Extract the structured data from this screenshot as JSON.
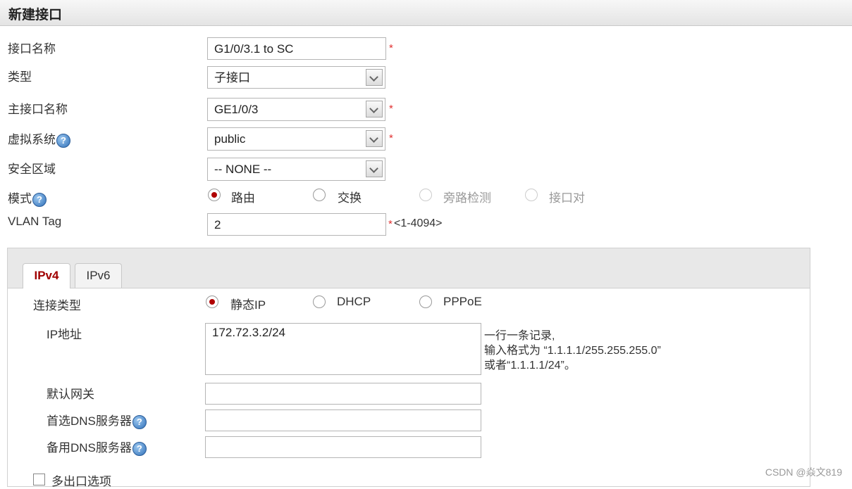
{
  "title": "新建接口",
  "form": {
    "name_label": "接口名称",
    "name_value": "G1/0/3.1 to SC",
    "type_label": "类型",
    "type_value": "子接口",
    "parent_label": "主接口名称",
    "parent_value": "GE1/0/3",
    "vsys_label": "虚拟系统",
    "vsys_value": "public",
    "zone_label": "安全区域",
    "zone_value": "-- NONE --",
    "mode_label": "模式",
    "mode_options": [
      "路由",
      "交换",
      "旁路检测",
      "接口对"
    ],
    "mode_selected": "路由",
    "vlan_label": "VLAN Tag",
    "vlan_value": "2",
    "vlan_range": "<1-4094>",
    "required_mark": "*",
    "help_glyph": "?"
  },
  "tabs": [
    "IPv4",
    "IPv6"
  ],
  "active_tab": "IPv4",
  "ipv4": {
    "conn_label": "连接类型",
    "conn_options": [
      "静态IP",
      "DHCP",
      "PPPoE"
    ],
    "conn_selected": "静态IP",
    "ip_label": "IP地址",
    "ip_value": "172.72.3.2/24",
    "ip_hint_1": "一行一条记录,",
    "ip_hint_2": "输入格式为 “1.1.1.1/255.255.255.0”",
    "ip_hint_3": "或者“1.1.1.1/24”。",
    "gateway_label": "默认网关",
    "gateway_value": "",
    "dns1_label": "首选DNS服务器",
    "dns1_value": "",
    "dns2_label": "备用DNS服务器",
    "dns2_value": "",
    "multi_exit_label": "多出口选项"
  },
  "watermark": "CSDN @焱文819",
  "colors": {
    "accent": "#a00000",
    "required": "#e03030",
    "help": "#2f6fb8"
  },
  "icons": [
    "help-icon",
    "chevron-down-icon",
    "radio-icon",
    "checkbox-icon"
  ]
}
